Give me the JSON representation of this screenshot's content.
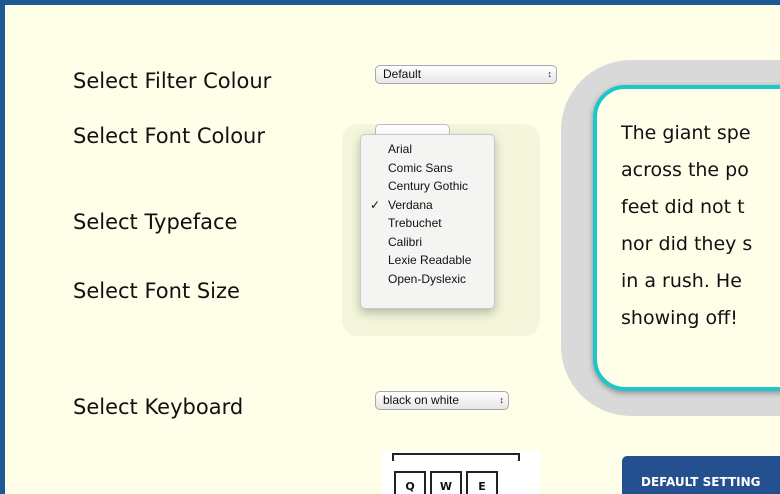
{
  "labels": {
    "filter": "Select Filter Colour",
    "font_colour": "Select Font Colour",
    "typeface": "Select Typeface",
    "font_size": "Select Font Size",
    "keyboard": "Select Keyboard"
  },
  "filter_select": {
    "value": "Default"
  },
  "keyboard_select": {
    "value": "black on white"
  },
  "typeface_menu": {
    "options": [
      "Arial",
      "Comic Sans",
      "Century Gothic",
      "Verdana",
      "Trebuchet",
      "Calibri",
      "Lexie Readable",
      "Open-Dyslexic"
    ],
    "selected": "Verdana"
  },
  "preview": {
    "lines": [
      "The giant spe",
      "across the po",
      "feet did not t",
      "nor did they s",
      "in a rush. He",
      "showing off!"
    ]
  },
  "keyboard_preview": {
    "keys": [
      "Q",
      "W",
      "E"
    ]
  },
  "default_button": {
    "label": "DEFAULT SETTING"
  },
  "colors": {
    "frame": "#1d5a93",
    "background": "#fefee9",
    "preview_border": "#1fc6c9",
    "button": "#24508f"
  },
  "icons": {
    "select_arrow": "updown-arrow-icon",
    "checkmark": "checkmark-icon"
  }
}
